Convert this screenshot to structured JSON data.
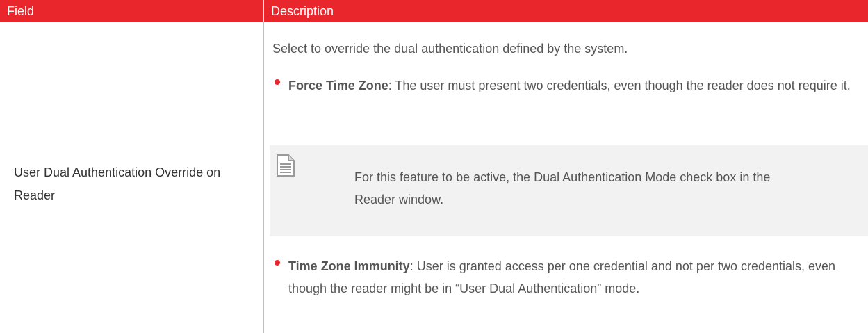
{
  "header": {
    "field_label": "Field",
    "description_label": "Description"
  },
  "row": {
    "field": "User Dual Authentication Override on Reader",
    "intro": "Select to override the dual authentication defined by the system.",
    "bullets": [
      {
        "term": "Force Time Zone",
        "text": ": The user must present two credentials, even though the reader does not require it."
      },
      {
        "term": "Time Zone Immunity",
        "text": ": User is granted access per one credential and not per two credentials, even though the reader might be in “User Dual Authentication” mode."
      }
    ],
    "note": {
      "icon": "document-note-icon",
      "text": "For this feature to be active, the Dual Authentication Mode check box in the Reader window."
    }
  },
  "colors": {
    "header_background": "#e9262b",
    "bullet": "#e9262b",
    "note_background": "#f2f2f2"
  }
}
